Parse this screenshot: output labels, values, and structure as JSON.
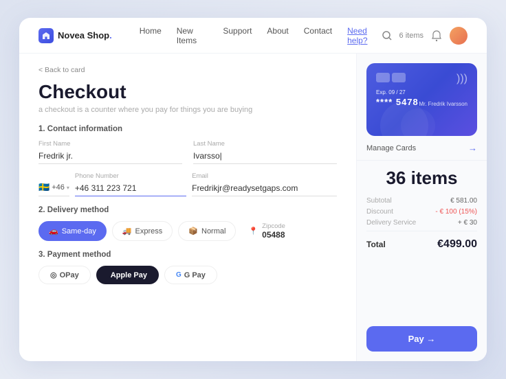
{
  "navbar": {
    "logo_text": "Novea Shop",
    "logo_dot": ".",
    "links": [
      "Home",
      "New Items",
      "Support",
      "About",
      "Contact"
    ],
    "need_help": "Need help?",
    "items_count": "6 items"
  },
  "back_link": "< Back to card",
  "page": {
    "title": "Checkout",
    "subtitle": "a checkout is a counter where you pay for things you are buying"
  },
  "sections": {
    "contact": "1. Contact information",
    "delivery": "2. Delivery method",
    "payment": "3. Payment method"
  },
  "form": {
    "first_name_label": "First Name",
    "first_name_value": "Fredrik jr.",
    "last_name_label": "Last Name",
    "last_name_value": "Ivarsso|",
    "country_code": "+46",
    "phone_label": "Phone Number",
    "phone_value": "+46 311 223 721",
    "email_label": "Email",
    "email_value": "Fredrikjr@readysetgaps.com"
  },
  "delivery": {
    "options": [
      "Same-day",
      "Express",
      "Normal"
    ],
    "active": "Same-day",
    "zipcode_label": "Zipcode",
    "zipcode_value": "05488"
  },
  "payment": {
    "options": [
      "OPay",
      "Apple Pay",
      "G Pay"
    ]
  },
  "card": {
    "chip_blocks": 2,
    "expiry_label": "Exp.",
    "expiry_value": "09 / 27",
    "number": "**** 5478",
    "name": "Mr. Fredrik Ivarsson"
  },
  "manage_cards": "Manage Cards",
  "items_count": "36 items",
  "summary": {
    "subtotal_label": "Subtotal",
    "subtotal_value": "€ 581.00",
    "discount_label": "Discount",
    "discount_value": "- € 100 (15%)",
    "delivery_label": "Delivery Service",
    "delivery_value": "+ € 30",
    "total_label": "Total",
    "total_value": "€499.00"
  },
  "pay_button": "Pay →"
}
